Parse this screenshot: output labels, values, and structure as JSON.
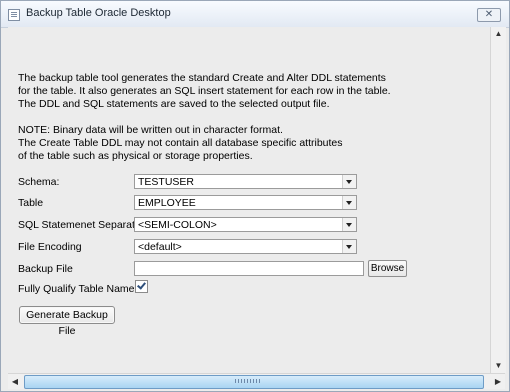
{
  "window": {
    "title": "Backup Table Oracle Desktop",
    "close_symbol": "✕"
  },
  "description": {
    "line1": "The backup table tool generates the standard Create and Alter DDL statements",
    "line2": "for the table. It also generates an SQL insert statement for each row in the table.",
    "line3": "The DDL and SQL statements are saved to the selected output file.",
    "line4": "",
    "line5": "NOTE: Binary data will be written out in character format.",
    "line6": "The Create Table DDL may not contain all database specific attributes",
    "line7": "of the table such as physical or storage properties."
  },
  "form": {
    "schema_label": "Schema:",
    "schema_value": "TESTUSER",
    "table_label": "Table",
    "table_value": "EMPLOYEE",
    "separator_label": "SQL Statemenet Separator",
    "separator_value": "<SEMI-COLON>",
    "encoding_label": "File Encoding",
    "encoding_value": "<default>",
    "backup_file_label": "Backup File",
    "backup_file_value": "",
    "browse_label": "Browse",
    "qualify_label": "Fully Qualify Table Name",
    "qualify_checked": true,
    "generate_label": "Generate Backup File"
  },
  "icons": {
    "window_icon": "document-icon",
    "scroll_up": "▲",
    "scroll_down": "▼",
    "scroll_left": "◀",
    "scroll_right": "▶"
  }
}
